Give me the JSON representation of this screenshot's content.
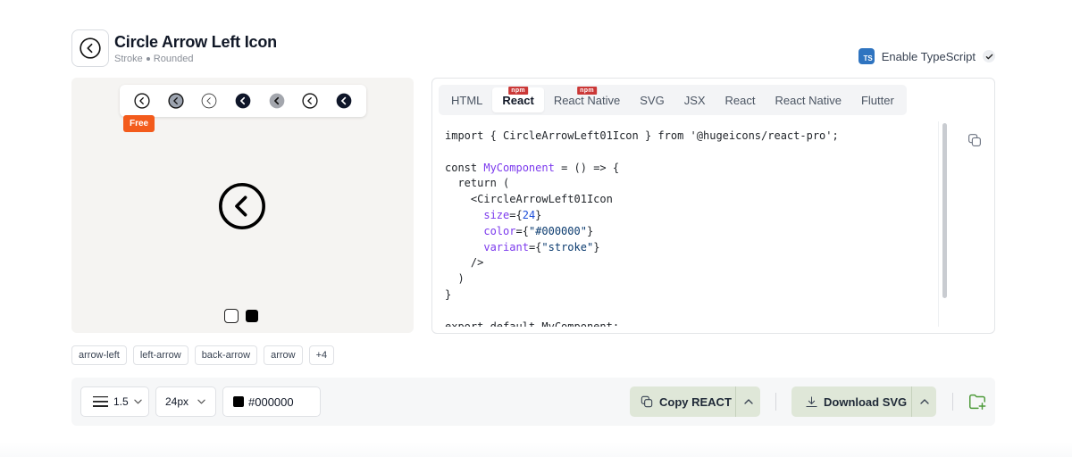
{
  "header": {
    "title": "Circle Arrow Left Icon",
    "style": "Stroke",
    "variant": "Rounded",
    "icon": "circle-arrow-left-icon"
  },
  "typescript": {
    "badge": "TS",
    "label": "Enable TypeScript",
    "enabled": true
  },
  "preview": {
    "free_label": "Free",
    "variant_icons": [
      "circle-arrow-left-stroke",
      "circle-arrow-left-duotone",
      "circle-arrow-left-light",
      "circle-arrow-left-solid",
      "circle-arrow-left-bulk",
      "circle-arrow-left-twotone",
      "circle-arrow-left-solid-sharp"
    ],
    "background_options": [
      "light",
      "dark"
    ]
  },
  "code_panel": {
    "tabs": [
      {
        "label": "HTML"
      },
      {
        "label": "React",
        "badge": "npm",
        "active": true
      },
      {
        "label": "React Native",
        "badge": "npm"
      },
      {
        "label": "SVG"
      },
      {
        "label": "JSX"
      },
      {
        "label": "React"
      },
      {
        "label": "React Native"
      },
      {
        "label": "Flutter"
      }
    ],
    "code": {
      "import_kw": "import",
      "import_rest": " { CircleArrowLeft01Icon } from '@hugeicons/react-pro';",
      "const_kw": "const ",
      "component_name": "MyComponent",
      "const_rest": " = () => {",
      "return_line": "  return (",
      "open_tag": "    <CircleArrowLeft01Icon",
      "size_attr": "size",
      "size_val": "24",
      "color_attr": "color",
      "color_val": "\"#000000\"",
      "variant_attr": "variant",
      "variant_val": "\"stroke\"",
      "self_close": "    />",
      "close_paren": "  )",
      "close_brace": "}",
      "export_line": "export default MyComponent;"
    }
  },
  "tags": [
    "arrow-left",
    "left-arrow",
    "back-arrow",
    "arrow",
    "+4"
  ],
  "toolbar": {
    "stroke_width": "1.5",
    "size": "24px",
    "color": "#000000",
    "copy_label": "Copy REACT",
    "download_label": "Download SVG"
  },
  "colors": {
    "accent_green": "#dfe7d8",
    "free_badge": "#f35b1c",
    "ts_badge": "#2f74c0",
    "npm_badge": "#cb3837"
  }
}
